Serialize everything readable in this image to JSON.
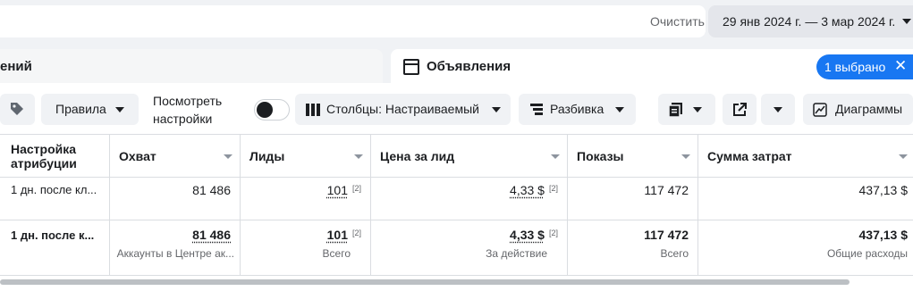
{
  "search": {
    "clear_label": "Очистить"
  },
  "date_range": {
    "label": "29 янв 2024 г. — 3 мар 2024 г."
  },
  "tabs": {
    "left_partial_label": "ений",
    "ads_label": "Объявления",
    "selected_label": "1 выбрано",
    "close_symbol": "✕"
  },
  "toolbar": {
    "rules_label": "Правила",
    "view_settings_line1": "Посмотреть",
    "view_settings_line2": "настройки",
    "columns_label": "Столбцы: Настраиваемый",
    "breakdown_label": "Разбивка",
    "charts_label": "Диаграммы"
  },
  "table": {
    "headers": [
      "Настройка атрибуции",
      "Охват",
      "Лиды",
      "Цена за лид",
      "Показы",
      "Сумма затрат"
    ],
    "header_attr_line1": "Настройка",
    "header_attr_line2": "атрибуции",
    "row": {
      "attribution": "1 дн. после кл...",
      "reach": "81 486",
      "leads": "101",
      "leads_note": "[2]",
      "cpl": "4,33 $",
      "cpl_note": "[2]",
      "impressions": "117 472",
      "spend": "437,13 $"
    },
    "total": {
      "attribution": "1 дн. после к...",
      "reach": "81 486",
      "reach_sub": "Аккаунты в Центре ак...",
      "leads": "101",
      "leads_note": "[2]",
      "leads_sub": "Всего",
      "cpl": "4,33 $",
      "cpl_note": "[2]",
      "cpl_sub": "За действие",
      "impressions": "117 472",
      "impressions_sub": "Всего",
      "spend": "437,13 $",
      "spend_sub": "Общие расходы"
    }
  }
}
